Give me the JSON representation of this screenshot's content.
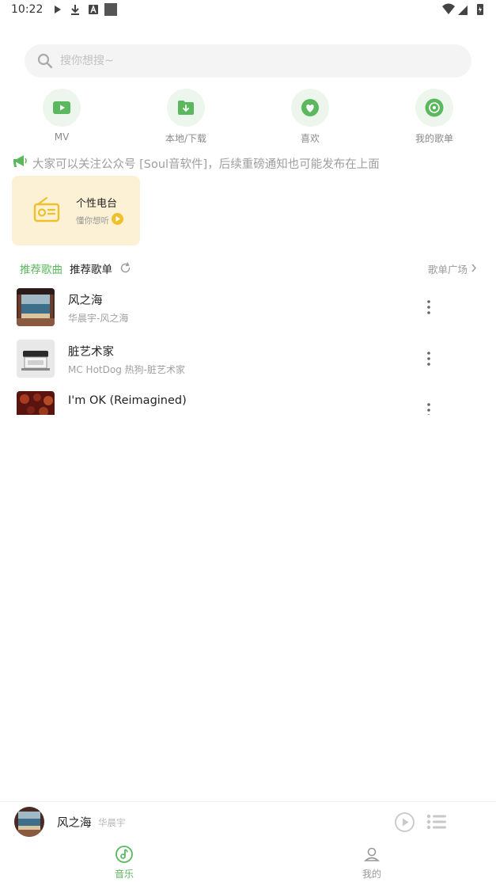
{
  "status_bar": {
    "time": "10:22"
  },
  "search": {
    "placeholder": "搜你想搜~"
  },
  "quick_nav": [
    {
      "label": "MV",
      "icon": "video-icon"
    },
    {
      "label": "本地/下载",
      "icon": "folder-download-icon"
    },
    {
      "label": "喜欢",
      "icon": "heart-icon"
    },
    {
      "label": "我的歌单",
      "icon": "disc-icon"
    }
  ],
  "notice": {
    "text": "大家可以关注公众号 [Soul音软件]，后续重磅通知也可能发布在上面"
  },
  "radio_card": {
    "title": "个性电台",
    "subtitle": "懂你想听"
  },
  "section": {
    "tab_songs": "推荐歌曲",
    "tab_playlists": "推荐歌单",
    "more_link": "歌单广场"
  },
  "songs": [
    {
      "title": "风之海",
      "subtitle": "华晨宇-风之海"
    },
    {
      "title": "脏艺术家",
      "subtitle": "MC HotDog 热狗-脏艺术家"
    },
    {
      "title": "I'm OK (Reimagined)",
      "subtitle": ""
    }
  ],
  "mini_player": {
    "title": "风之海",
    "artist": "华晨宇"
  },
  "bottom_nav": [
    {
      "label": "音乐",
      "active": true
    },
    {
      "label": "我的",
      "active": false
    }
  ],
  "colors": {
    "accent": "#5bb85e",
    "card_bg": "#fcf1d5",
    "radio_yellow": "#f0c02a",
    "icon_bg": "#ecf6ec"
  }
}
